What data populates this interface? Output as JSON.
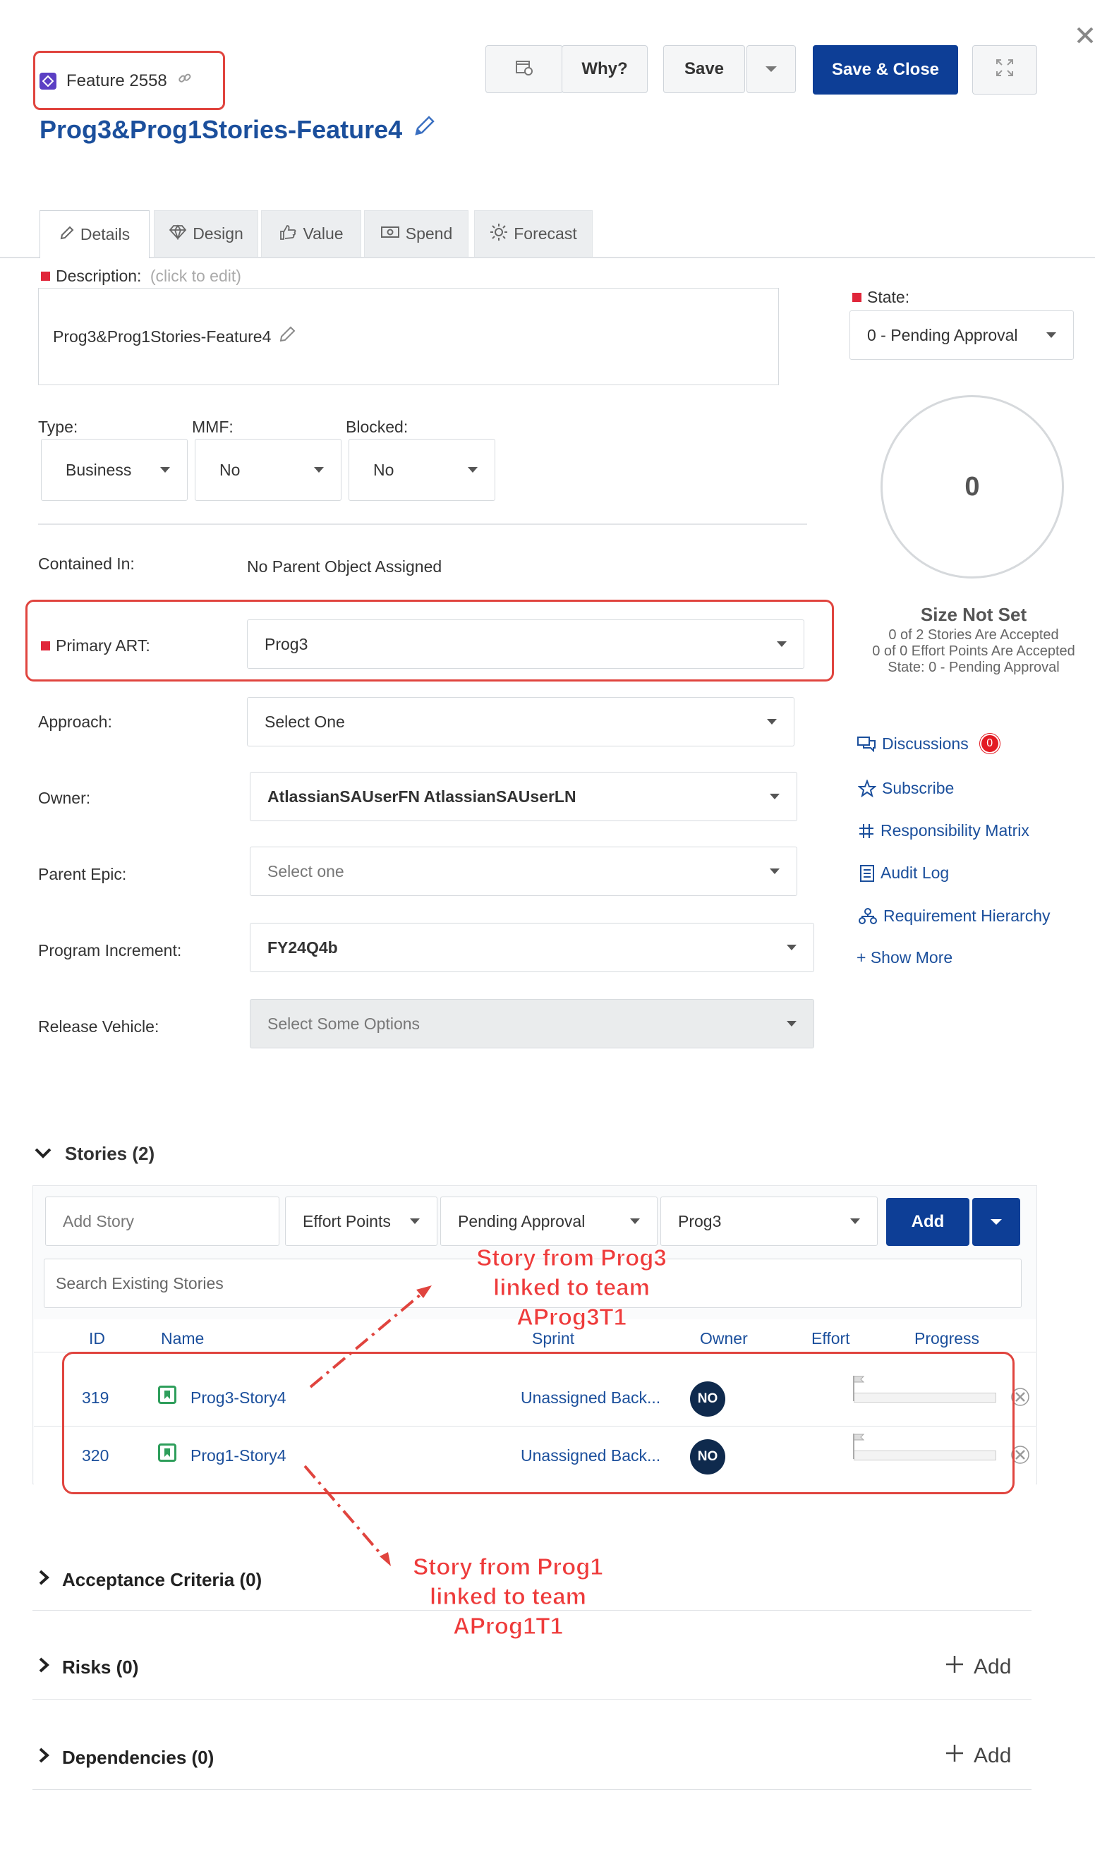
{
  "header": {
    "object_id": "Feature 2558",
    "title": "Prog3&Prog1Stories-Feature4",
    "toolbar": {
      "why_label": "Why?",
      "save_label": "Save",
      "save_close_label": "Save & Close"
    }
  },
  "tabs": [
    {
      "label": "Details",
      "icon": "pencil-icon"
    },
    {
      "label": "Design",
      "icon": "diamond-icon"
    },
    {
      "label": "Value",
      "icon": "thumbs-up-icon"
    },
    {
      "label": "Spend",
      "icon": "money-icon"
    },
    {
      "label": "Forecast",
      "icon": "sun-icon"
    }
  ],
  "description": {
    "label": "Description:",
    "hint": "(click to edit)",
    "text": "Prog3&Prog1Stories-Feature4"
  },
  "state": {
    "label": "State:",
    "value": "0 - Pending Approval"
  },
  "fields": {
    "type": {
      "label": "Type:",
      "value": "Business"
    },
    "mmf": {
      "label": "MMF:",
      "value": "No"
    },
    "blocked": {
      "label": "Blocked:",
      "value": "No"
    },
    "contained_in": {
      "label": "Contained In:",
      "value": "No Parent Object Assigned"
    },
    "primary_art": {
      "label": "Primary ART:",
      "value": "Prog3"
    },
    "approach": {
      "label": "Approach:",
      "value": "Select One"
    },
    "owner": {
      "label": "Owner:",
      "value": "AtlassianSAUserFN AtlassianSAUserLN"
    },
    "parent_epic": {
      "label": "Parent Epic:",
      "value": "Select one"
    },
    "program_increment": {
      "label": "Program Increment:",
      "value": "FY24Q4b"
    },
    "release_vehicle": {
      "label": "Release Vehicle:",
      "value": "Select Some Options"
    }
  },
  "size_gauge": {
    "value": "0",
    "title": "Size Not Set",
    "stories_line": "0 of 2 Stories Are Accepted",
    "effort_line": "0 of 0 Effort Points Are Accepted",
    "state_line": "State: 0 - Pending Approval"
  },
  "side_links": [
    {
      "label": "Discussions",
      "icon": "discussions-icon",
      "badge": "0"
    },
    {
      "label": "Subscribe",
      "icon": "star-icon"
    },
    {
      "label": "Responsibility Matrix",
      "icon": "grid-icon"
    },
    {
      "label": "Audit Log",
      "icon": "log-icon"
    },
    {
      "label": "Requirement Hierarchy",
      "icon": "hierarchy-icon"
    },
    {
      "label": "+ Show More",
      "icon": ""
    }
  ],
  "stories": {
    "header": "Stories (2)",
    "add_story_placeholder": "Add Story",
    "effort_select": "Effort Points",
    "state_select": "Pending Approval",
    "art_select": "Prog3",
    "add_label": "Add",
    "search_placeholder": "Search Existing Stories",
    "columns": [
      "ID",
      "Name",
      "Sprint",
      "Owner",
      "Effort",
      "Progress"
    ],
    "rows": [
      {
        "id": "319",
        "name": "Prog3-Story4",
        "sprint": "Unassigned Back...",
        "owner": "NO",
        "progress": 0
      },
      {
        "id": "320",
        "name": "Prog1-Story4",
        "sprint": "Unassigned Back...",
        "owner": "NO",
        "progress": 0
      }
    ]
  },
  "annotations": {
    "prog3": "Story from Prog3\nlinked to team\nAProg3T1",
    "prog1": "Story from Prog1\nlinked to team\nAProg1T1"
  },
  "sections": {
    "acceptance": "Acceptance Criteria (0)",
    "risks": "Risks (0)",
    "dependencies": "Dependencies (0)",
    "add_label": "Add"
  },
  "colors": {
    "accent": "#0d3e96",
    "link": "#1b4f9c",
    "required": "#e0263a",
    "annotation": "#ee3b3b",
    "story_icon": "#2e9e5b"
  }
}
